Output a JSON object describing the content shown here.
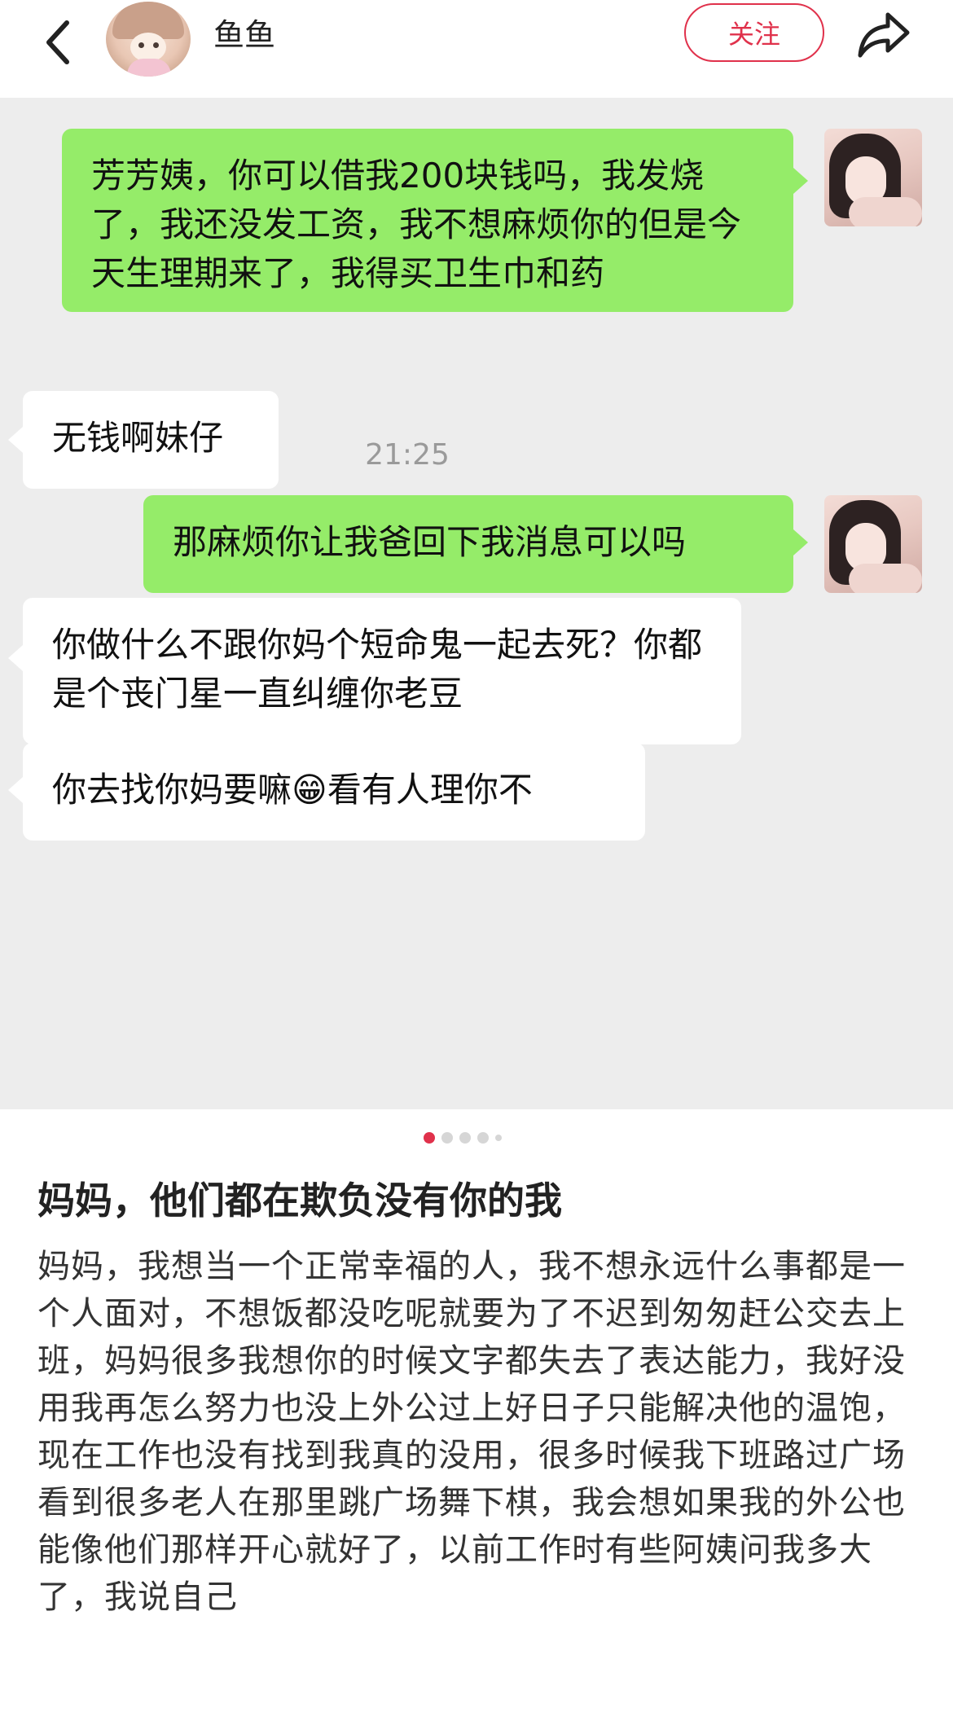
{
  "header": {
    "username": "鱼鱼",
    "follow_label": "关注",
    "icons": {
      "back": "back-chevron-icon",
      "share": "share-arrow-icon"
    }
  },
  "chat": {
    "messages": [
      {
        "side": "right",
        "text": "芳芳姨，你可以借我200块钱吗，我发烧了，我还没发工资，我不想麻烦你的但是今天生理期来了，我得买卫生巾和药"
      },
      {
        "side": "right",
        "text": "那麻烦你让我爸回下我消息可以吗"
      },
      {
        "side": "left",
        "text": "无钱啊妹仔"
      },
      {
        "side": "left",
        "text": "你做什么不跟你妈个短命鬼一起去死？你都是个丧门星一直纠缠你老豆"
      },
      {
        "side": "left",
        "text_before": "你去找你妈要嘛",
        "emoji": "😁",
        "text_after": "看有人理你不"
      }
    ],
    "timestamp": "21:25",
    "colors": {
      "background": "#ededed",
      "sent_bubble": "#95ec69",
      "received_bubble": "#ffffff"
    }
  },
  "carousel": {
    "count": 5,
    "active_index": 0,
    "active_color": "#e0314b"
  },
  "post": {
    "title": "妈妈，他们都在欺负没有你的我",
    "body": "妈妈，我想当一个正常幸福的人，我不想永远什么事都是一个人面对，不想饭都没吃呢就要为了不迟到匆匆赶公交去上班，妈妈很多我想你的时候文字都失去了表达能力，我好没用我再怎么努力也没上外公过上好日子只能解决他的温饱，现在工作也没有找到我真的没用，很多时候我下班路过广场看到很多老人在那里跳广场舞下棋，我会想如果我的外公也能像他们那样开心就好了，以前工作时有些阿姨问我多大了，我说自己"
  },
  "colors": {
    "accent": "#e0314b"
  }
}
